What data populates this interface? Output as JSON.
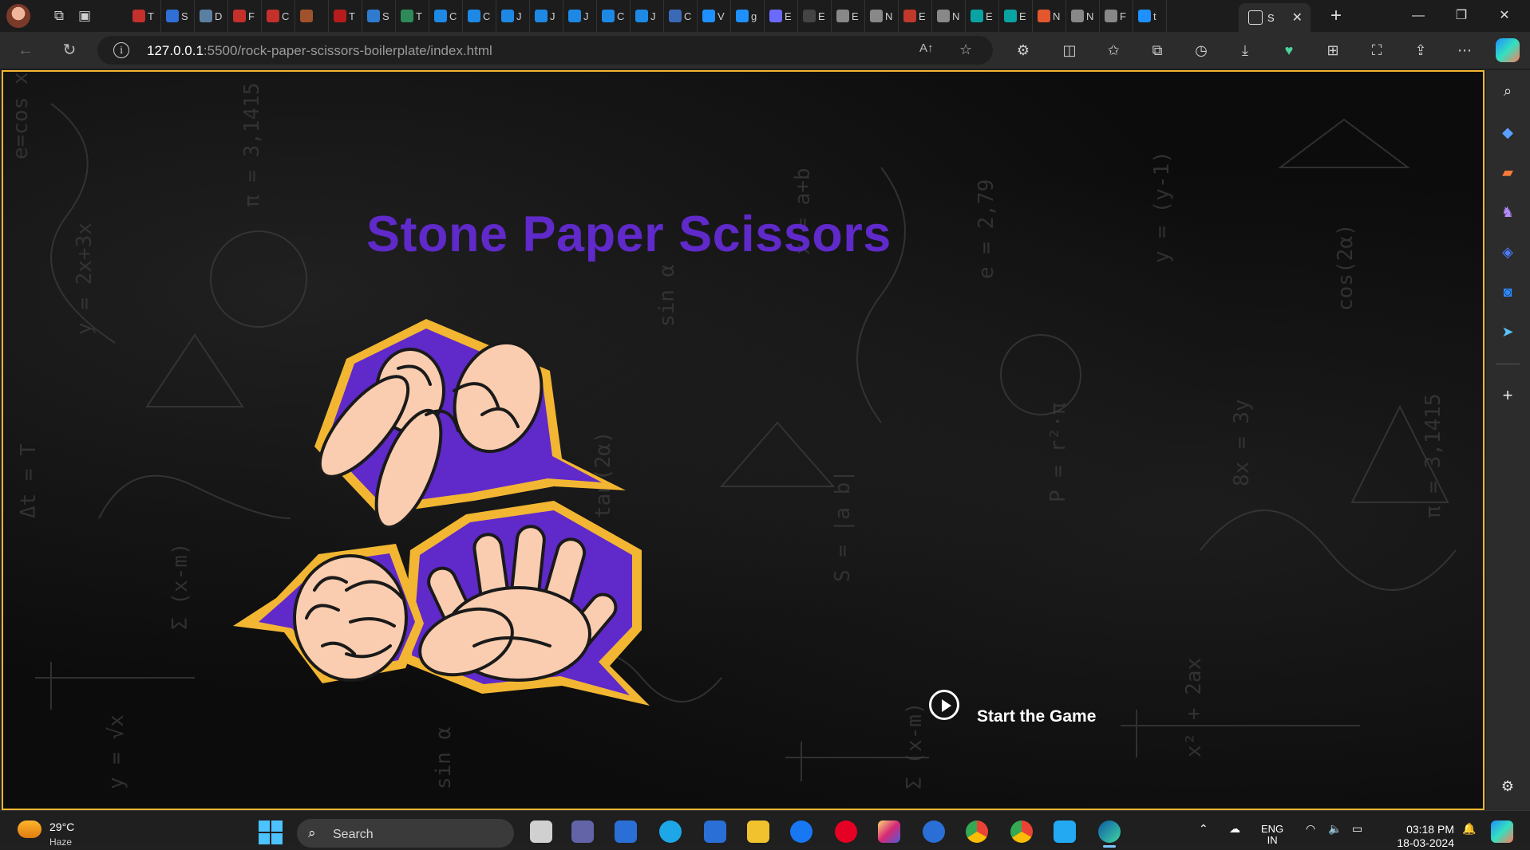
{
  "browser": {
    "tabs": [
      {
        "label": "T",
        "color": "#c4302b"
      },
      {
        "label": "S",
        "color": "#2f6fd6"
      },
      {
        "label": "D",
        "color": "#5a7fa0"
      },
      {
        "label": "F",
        "color": "#c4302b"
      },
      {
        "label": "C",
        "color": "#c4302b"
      },
      {
        "label": "",
        "color": "#a0522d"
      },
      {
        "label": "T",
        "color": "#b71c1c"
      },
      {
        "label": "S",
        "color": "#2e7bd0"
      },
      {
        "label": "T",
        "color": "#2e8b57"
      },
      {
        "label": "C",
        "color": "#1e88e5"
      },
      {
        "label": "C",
        "color": "#1e88e5"
      },
      {
        "label": "J",
        "color": "#1e88e5"
      },
      {
        "label": "J",
        "color": "#1e88e5"
      },
      {
        "label": "J",
        "color": "#1e88e5"
      },
      {
        "label": "C",
        "color": "#1e88e5"
      },
      {
        "label": "J",
        "color": "#1e88e5"
      },
      {
        "label": "C",
        "color": "#3a6ab6"
      },
      {
        "label": "V",
        "color": "#1e90ff"
      },
      {
        "label": "g",
        "color": "#1e90ff"
      },
      {
        "label": "E",
        "color": "#6a6aff"
      },
      {
        "label": "E",
        "color": "#444"
      },
      {
        "label": "E",
        "color": "#888"
      },
      {
        "label": "N",
        "color": "#888"
      },
      {
        "label": "E",
        "color": "#c0392b"
      },
      {
        "label": "N",
        "color": "#888"
      },
      {
        "label": "E",
        "color": "#0aa3a3"
      },
      {
        "label": "E",
        "color": "#0aa3a3"
      },
      {
        "label": "N",
        "color": "#e4572e"
      },
      {
        "label": "N",
        "color": "#888"
      },
      {
        "label": "F",
        "color": "#888"
      },
      {
        "label": "t",
        "color": "#1e90ff"
      }
    ],
    "active_tab": {
      "label": "S",
      "close": "✕"
    },
    "new_tab": "+",
    "window": {
      "minimize": "—",
      "maximize": "❐",
      "close": "✕"
    },
    "url_host": "127.0.0.1",
    "url_path": ":5500/rock-paper-scissors-boilerplate/index.html",
    "read_aloud": "A↑"
  },
  "page": {
    "title": "Stone Paper Scissors",
    "start_label": "Start the Game",
    "accent_color": "#6029c9",
    "border_color": "#f2b632"
  },
  "taskbar": {
    "weather_temp": "29°C",
    "weather_desc": "Haze",
    "search_label": "Search",
    "lang_line1": "ENG",
    "lang_line2": "IN",
    "time": "03:18 PM",
    "date": "18-03-2024"
  }
}
